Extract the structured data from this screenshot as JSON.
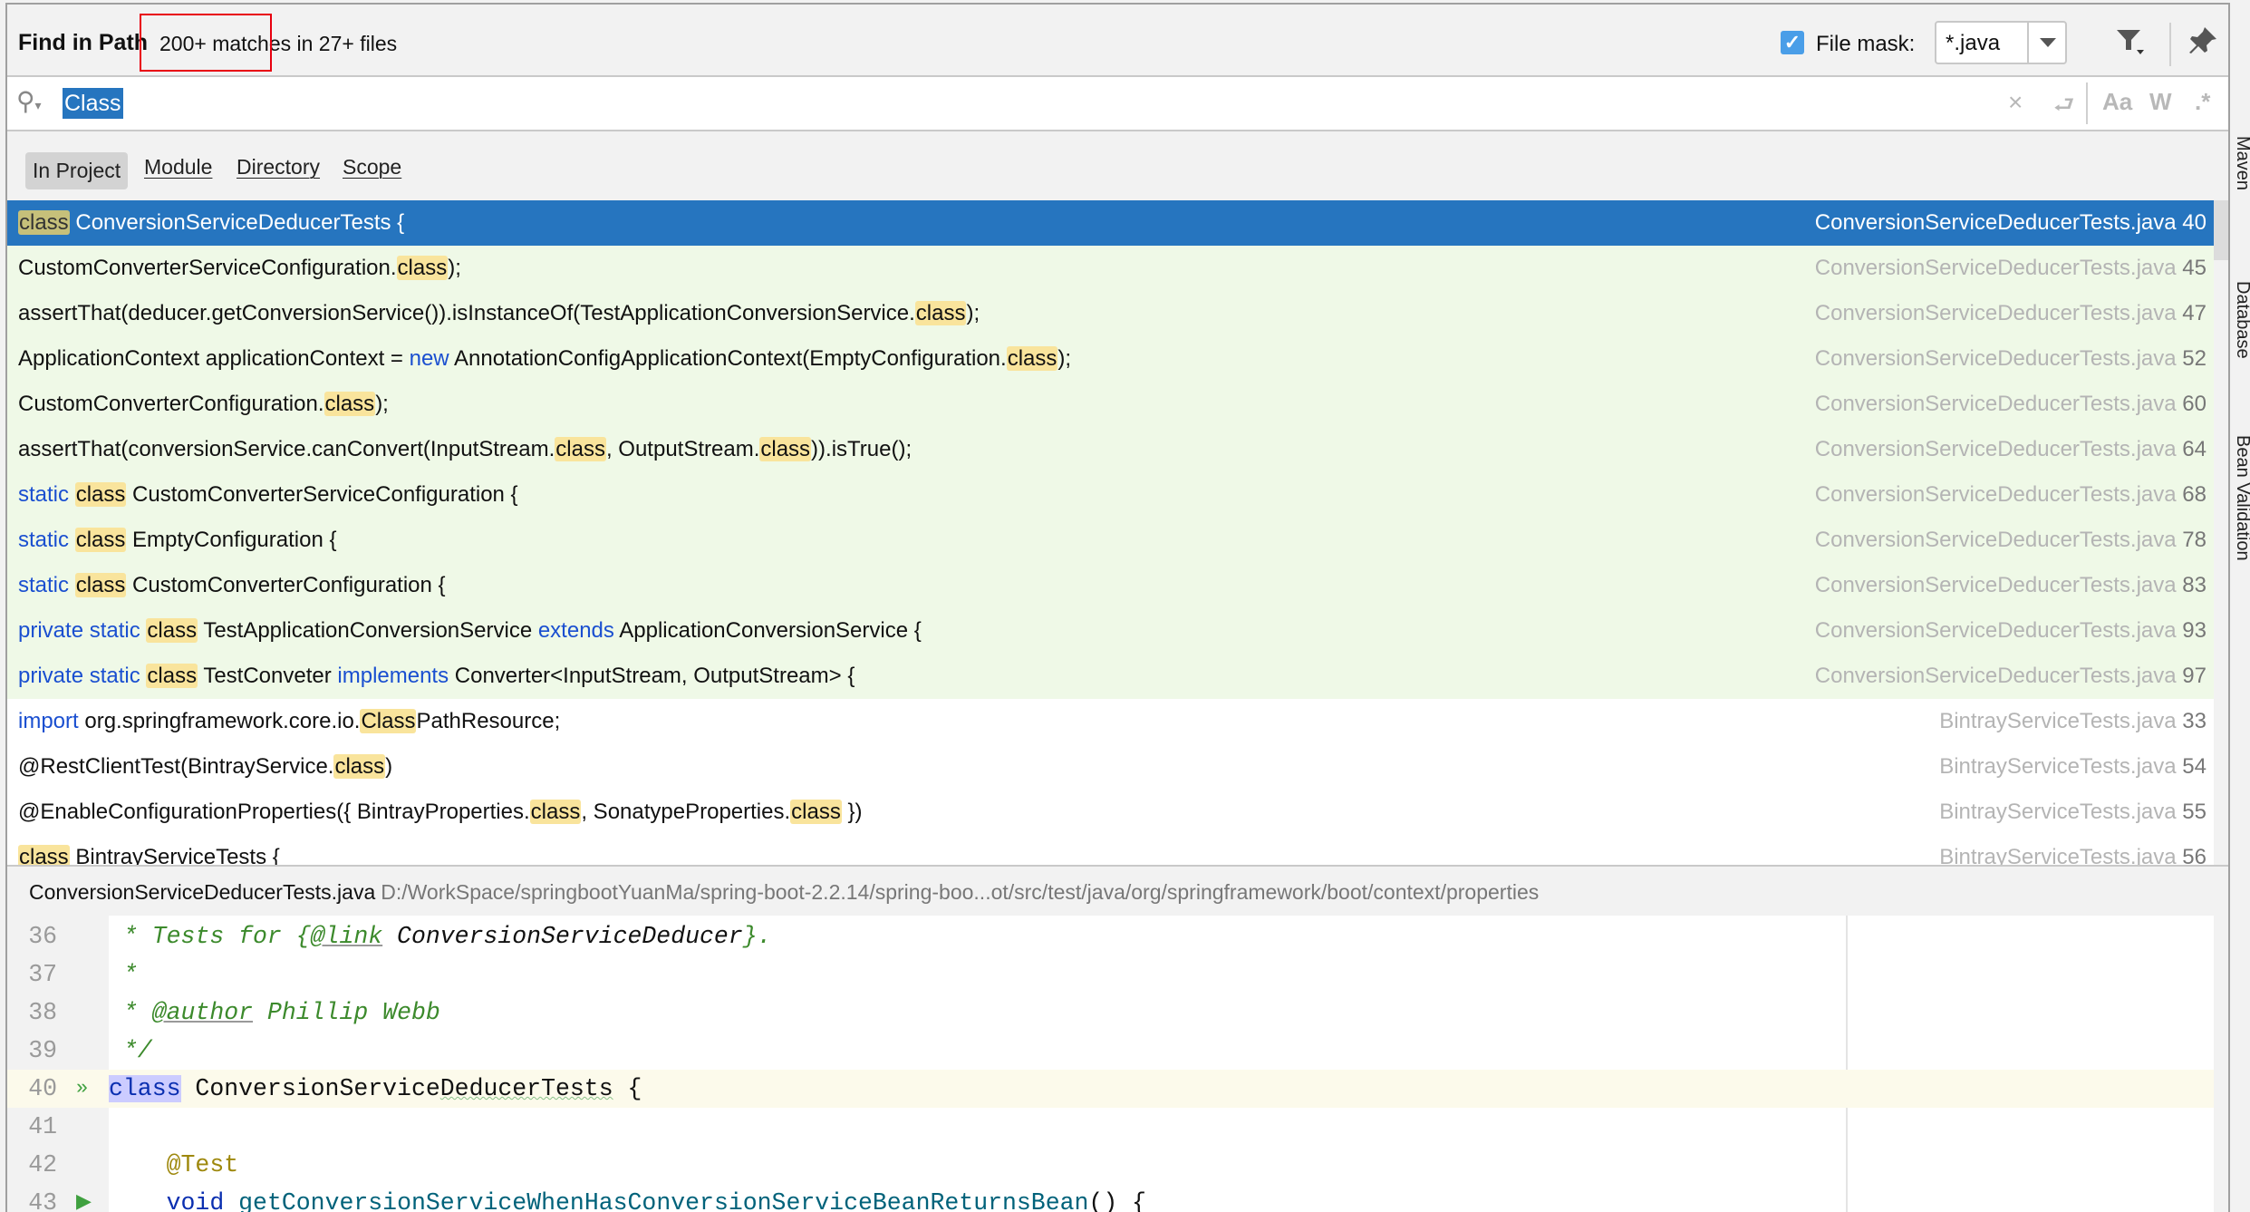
{
  "header": {
    "title": "Find in Path",
    "match_count": "200+ matches in 27+ files",
    "file_mask_checked": true,
    "file_mask_label": "File mask:",
    "file_mask_value": "*.java",
    "filter_icon": "filter-icon",
    "pin_icon": "pin-icon"
  },
  "search": {
    "icon": "search-icon",
    "value": "Class",
    "clear_icon": "×",
    "newline_icon": "⮐",
    "match_case": "Aa",
    "words": "W",
    "regex": ".*"
  },
  "scopes": [
    {
      "label": "In Project",
      "active": true
    },
    {
      "label": "Module"
    },
    {
      "label": "Directory"
    },
    {
      "label": "Scope"
    }
  ],
  "results": [
    {
      "state": "selected",
      "segments": [
        {
          "t": "class",
          "k": "hl"
        },
        {
          "t": " ConversionServiceDeducerTests {"
        }
      ],
      "file": "ConversionServiceDeducerTests.java",
      "line": "40"
    },
    {
      "state": "same",
      "segments": [
        {
          "t": "CustomConverterServiceConfiguration."
        },
        {
          "t": "class",
          "k": "hl"
        },
        {
          "t": ");"
        }
      ],
      "file": "ConversionServiceDeducerTests.java",
      "line": "45"
    },
    {
      "state": "same",
      "segments": [
        {
          "t": "assertThat(deducer.getConversionService()).isInstanceOf(TestApplicationConversionService."
        },
        {
          "t": "class",
          "k": "hl"
        },
        {
          "t": ");"
        }
      ],
      "file": "ConversionServiceDeducerTests.java",
      "line": "47"
    },
    {
      "state": "same",
      "segments": [
        {
          "t": "ApplicationContext applicationContext = "
        },
        {
          "t": "new",
          "k": "kw"
        },
        {
          "t": " AnnotationConfigApplicationContext(EmptyConfiguration."
        },
        {
          "t": "class",
          "k": "hl"
        },
        {
          "t": ");"
        }
      ],
      "file": "ConversionServiceDeducerTests.java",
      "line": "52"
    },
    {
      "state": "same",
      "segments": [
        {
          "t": "CustomConverterConfiguration."
        },
        {
          "t": "class",
          "k": "hl"
        },
        {
          "t": ");"
        }
      ],
      "file": "ConversionServiceDeducerTests.java",
      "line": "60"
    },
    {
      "state": "same",
      "segments": [
        {
          "t": "assertThat(conversionService.canConvert(InputStream."
        },
        {
          "t": "class",
          "k": "hl"
        },
        {
          "t": ", OutputStream."
        },
        {
          "t": "class",
          "k": "hl"
        },
        {
          "t": ")).isTrue();"
        }
      ],
      "file": "ConversionServiceDeducerTests.java",
      "line": "64"
    },
    {
      "state": "same",
      "segments": [
        {
          "t": "static",
          "k": "kw"
        },
        {
          "t": " "
        },
        {
          "t": "class",
          "k": "hl"
        },
        {
          "t": " CustomConverterServiceConfiguration {"
        }
      ],
      "file": "ConversionServiceDeducerTests.java",
      "line": "68"
    },
    {
      "state": "same",
      "segments": [
        {
          "t": "static",
          "k": "kw"
        },
        {
          "t": " "
        },
        {
          "t": "class",
          "k": "hl"
        },
        {
          "t": " EmptyConfiguration {"
        }
      ],
      "file": "ConversionServiceDeducerTests.java",
      "line": "78"
    },
    {
      "state": "same",
      "segments": [
        {
          "t": "static",
          "k": "kw"
        },
        {
          "t": " "
        },
        {
          "t": "class",
          "k": "hl"
        },
        {
          "t": " CustomConverterConfiguration {"
        }
      ],
      "file": "ConversionServiceDeducerTests.java",
      "line": "83"
    },
    {
      "state": "same",
      "segments": [
        {
          "t": "private static",
          "k": "kw"
        },
        {
          "t": " "
        },
        {
          "t": "class",
          "k": "hl"
        },
        {
          "t": " TestApplicationConversionService "
        },
        {
          "t": "extends",
          "k": "kw"
        },
        {
          "t": " ApplicationConversionService {"
        }
      ],
      "file": "ConversionServiceDeducerTests.java",
      "line": "93"
    },
    {
      "state": "same",
      "segments": [
        {
          "t": "private static",
          "k": "kw"
        },
        {
          "t": " "
        },
        {
          "t": "class",
          "k": "hl"
        },
        {
          "t": " TestConveter "
        },
        {
          "t": "implements",
          "k": "kw"
        },
        {
          "t": " Converter<InputStream, OutputStream> {"
        }
      ],
      "file": "ConversionServiceDeducerTests.java",
      "line": "97"
    },
    {
      "state": "other",
      "segments": [
        {
          "t": "import",
          "k": "kw"
        },
        {
          "t": " org.springframework.core.io."
        },
        {
          "t": "Class",
          "k": "hl"
        },
        {
          "t": "PathResource;"
        }
      ],
      "file": "BintrayServiceTests.java",
      "line": "33"
    },
    {
      "state": "other",
      "segments": [
        {
          "t": "@RestClientTest(BintrayService."
        },
        {
          "t": "class",
          "k": "hl"
        },
        {
          "t": ")"
        }
      ],
      "file": "BintrayServiceTests.java",
      "line": "54"
    },
    {
      "state": "other",
      "segments": [
        {
          "t": "@EnableConfigurationProperties({ BintrayProperties."
        },
        {
          "t": "class",
          "k": "hl"
        },
        {
          "t": ", SonatypeProperties."
        },
        {
          "t": "class",
          "k": "hl"
        },
        {
          "t": " })"
        }
      ],
      "file": "BintrayServiceTests.java",
      "line": "55"
    },
    {
      "state": "other",
      "segments": [
        {
          "t": "class",
          "k": "hl"
        },
        {
          "t": " BintrayServiceTests {"
        }
      ],
      "file": "BintrayServiceTests.java",
      "line": "56"
    }
  ],
  "preview": {
    "file_name": "ConversionServiceDeducerTests.java",
    "path": "D:/WorkSpace/springbootYuanMa/spring-boot-2.2.14/spring-boo...ot/src/test/java/org/springframework/boot/context/properties",
    "lines": [
      {
        "num": "36",
        "segments": [
          {
            "t": " * Tests for {",
            "k": "com"
          },
          {
            "t": "@link",
            "k": "tag"
          },
          {
            "t": " ConversionServiceDeducer",
            "k": "cref"
          },
          {
            "t": "}.",
            "k": "com"
          }
        ]
      },
      {
        "num": "37",
        "segments": [
          {
            "t": " *",
            "k": "com"
          }
        ]
      },
      {
        "num": "38",
        "segments": [
          {
            "t": " * ",
            "k": "com"
          },
          {
            "t": "@author",
            "k": "tag"
          },
          {
            "t": " Phillip Webb",
            "k": "com"
          }
        ]
      },
      {
        "num": "39",
        "segments": [
          {
            "t": " */",
            "k": "com"
          }
        ]
      },
      {
        "num": "40",
        "current": true,
        "run": "»",
        "segments": [
          {
            "t": "class",
            "k": "kwsel"
          },
          {
            "t": " ConversionService"
          },
          {
            "t": "DeducerTests",
            "k": "wavy"
          },
          {
            "t": " {"
          }
        ]
      },
      {
        "num": "41",
        "segments": []
      },
      {
        "num": "42",
        "segments": [
          {
            "t": "    "
          },
          {
            "t": "@Test",
            "k": "ann"
          }
        ]
      },
      {
        "num": "43",
        "run": "▶",
        "segments": [
          {
            "t": "    "
          },
          {
            "t": "void",
            "k": "kw"
          },
          {
            "t": " "
          },
          {
            "t": "getConversionServiceWhenHasConversionServiceBeanReturnsBean",
            "k": "meth"
          },
          {
            "t": "() {"
          }
        ]
      }
    ]
  },
  "side_tools": [
    "Maven",
    "Database",
    "Bean Validation"
  ],
  "colors": {
    "selection": "#2675bf",
    "same_file_row": "#eff9e7",
    "match_highlight": "#f9e49c",
    "keyword": "#0a2fb0",
    "comment": "#3c8a2c",
    "annotation": "#9e880d",
    "annotation_box": "#e8000f"
  }
}
